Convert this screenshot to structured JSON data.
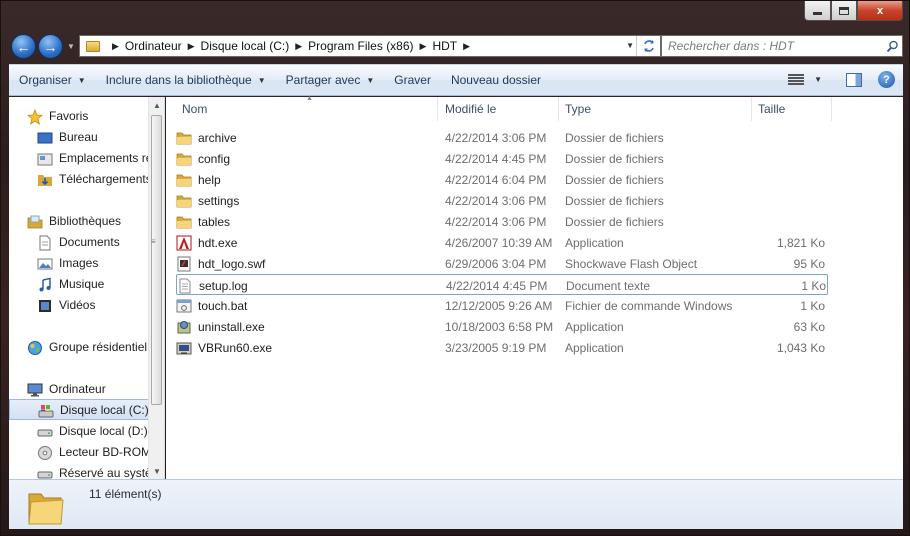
{
  "window": {
    "caption": {
      "minimize": "",
      "maximize": "",
      "close": "x"
    }
  },
  "address": {
    "crumbs": [
      "Ordinateur",
      "Disque local (C:)",
      "Program Files (x86)",
      "HDT"
    ],
    "search_placeholder": "Rechercher dans : HDT"
  },
  "toolbar": {
    "organize": "Organiser",
    "include": "Inclure dans la bibliothèque",
    "share": "Partager avec",
    "burn": "Graver",
    "new_folder": "Nouveau dossier"
  },
  "sidebar": {
    "items": [
      {
        "label": "Favoris",
        "icon": "star-icon",
        "level": 0
      },
      {
        "label": "Bureau",
        "icon": "desktop-icon",
        "level": 1
      },
      {
        "label": "Emplacements ré",
        "icon": "recent-places-icon",
        "level": 1
      },
      {
        "label": "Téléchargements",
        "icon": "downloads-folder-icon",
        "level": 1
      },
      {
        "label": "Bibliothèques",
        "icon": "libraries-icon",
        "level": 0
      },
      {
        "label": "Documents",
        "icon": "documents-icon",
        "level": 1
      },
      {
        "label": "Images",
        "icon": "pictures-icon",
        "level": 1
      },
      {
        "label": "Musique",
        "icon": "music-icon",
        "level": 1
      },
      {
        "label": "Vidéos",
        "icon": "videos-icon",
        "level": 1
      },
      {
        "label": "Groupe résidentiel",
        "icon": "homegroup-icon",
        "level": 0
      },
      {
        "label": "Ordinateur",
        "icon": "computer-icon",
        "level": 0
      },
      {
        "label": "Disque local (C:)",
        "icon": "system-drive-icon",
        "level": 1,
        "selected": true
      },
      {
        "label": "Disque local (D:)",
        "icon": "drive-icon",
        "level": 1
      },
      {
        "label": "Lecteur BD-ROM",
        "icon": "optical-drive-icon",
        "level": 1
      },
      {
        "label": "Réservé au systèr",
        "icon": "drive-icon",
        "level": 1
      }
    ]
  },
  "columns": {
    "name": "Nom",
    "date": "Modifié le",
    "type": "Type",
    "size": "Taille"
  },
  "files": [
    {
      "name": "archive",
      "date": "4/22/2014 3:06 PM",
      "type": "Dossier de fichiers",
      "size": "",
      "icon": "folder-icon"
    },
    {
      "name": "config",
      "date": "4/22/2014 4:45 PM",
      "type": "Dossier de fichiers",
      "size": "",
      "icon": "folder-icon"
    },
    {
      "name": "help",
      "date": "4/22/2014 6:04 PM",
      "type": "Dossier de fichiers",
      "size": "",
      "icon": "folder-icon"
    },
    {
      "name": "settings",
      "date": "4/22/2014 3:06 PM",
      "type": "Dossier de fichiers",
      "size": "",
      "icon": "folder-icon"
    },
    {
      "name": "tables",
      "date": "4/22/2014 3:06 PM",
      "type": "Dossier de fichiers",
      "size": "",
      "icon": "folder-icon"
    },
    {
      "name": "hdt.exe",
      "date": "4/26/2007 10:39 AM",
      "type": "Application",
      "size": "1,821 Ko",
      "icon": "hdt-app-icon"
    },
    {
      "name": "hdt_logo.swf",
      "date": "6/29/2006 3:04 PM",
      "type": "Shockwave Flash Object",
      "size": "95 Ko",
      "icon": "flash-file-icon"
    },
    {
      "name": "setup.log",
      "date": "4/22/2014 4:45 PM",
      "type": "Document texte",
      "size": "1 Ko",
      "icon": "text-file-icon",
      "focused": true
    },
    {
      "name": "touch.bat",
      "date": "12/12/2005 9:26 AM",
      "type": "Fichier de commande Windows",
      "size": "1 Ko",
      "icon": "batch-file-icon"
    },
    {
      "name": "uninstall.exe",
      "date": "10/18/2003 6:58 PM",
      "type": "Application",
      "size": "63 Ko",
      "icon": "uninstall-app-icon"
    },
    {
      "name": "VBRun60.exe",
      "date": "3/23/2005 9:19 PM",
      "type": "Application",
      "size": "1,043 Ko",
      "icon": "installer-app-icon"
    }
  ],
  "details": {
    "count": "11 élément(s)"
  }
}
